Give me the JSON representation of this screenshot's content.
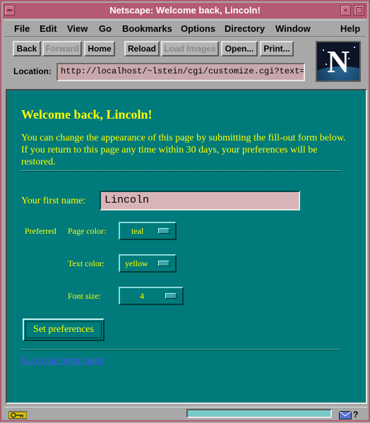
{
  "window": {
    "title": "Netscape: Welcome back, Lincoln!"
  },
  "menubar": {
    "items": [
      "File",
      "Edit",
      "View",
      "Go",
      "Bookmarks",
      "Options",
      "Directory",
      "Window",
      "Help"
    ]
  },
  "toolbar": {
    "buttons": [
      "Back",
      "Forward",
      "Home",
      "Reload",
      "Load Images",
      "Open...",
      "Print..."
    ],
    "location_label": "Location:",
    "location_value": "http://localhost/~lstein/cgi/customize.cgi?text=y",
    "logo_letter": "N"
  },
  "page": {
    "heading": "Welcome back, Lincoln!",
    "intro": "You can change the appearance of this page by submitting the fill-out form below. If you return to this page any time within 30 days, your preferences will be restored.",
    "first_name_label": "Your first name:",
    "first_name_value": "Lincoln",
    "preferred_label": "Preferred",
    "page_color_label": "Page color:",
    "page_color_value": "teal",
    "text_color_label": "Text color:",
    "text_color_value": "yellow",
    "font_size_label": "Font size:",
    "font_size_value": "4",
    "submit_label": "Set preferences",
    "home_link": "Go to the home page"
  },
  "colors": {
    "page_background": "#007a7a",
    "text": "#ffff00",
    "link": "#5050ff",
    "title_bar": "#b45a72",
    "chrome": "#a8a8a8"
  },
  "icons": [
    "minimize-icon",
    "maximize-icon",
    "netscape-logo",
    "security-key-icon",
    "mail-icon"
  ]
}
